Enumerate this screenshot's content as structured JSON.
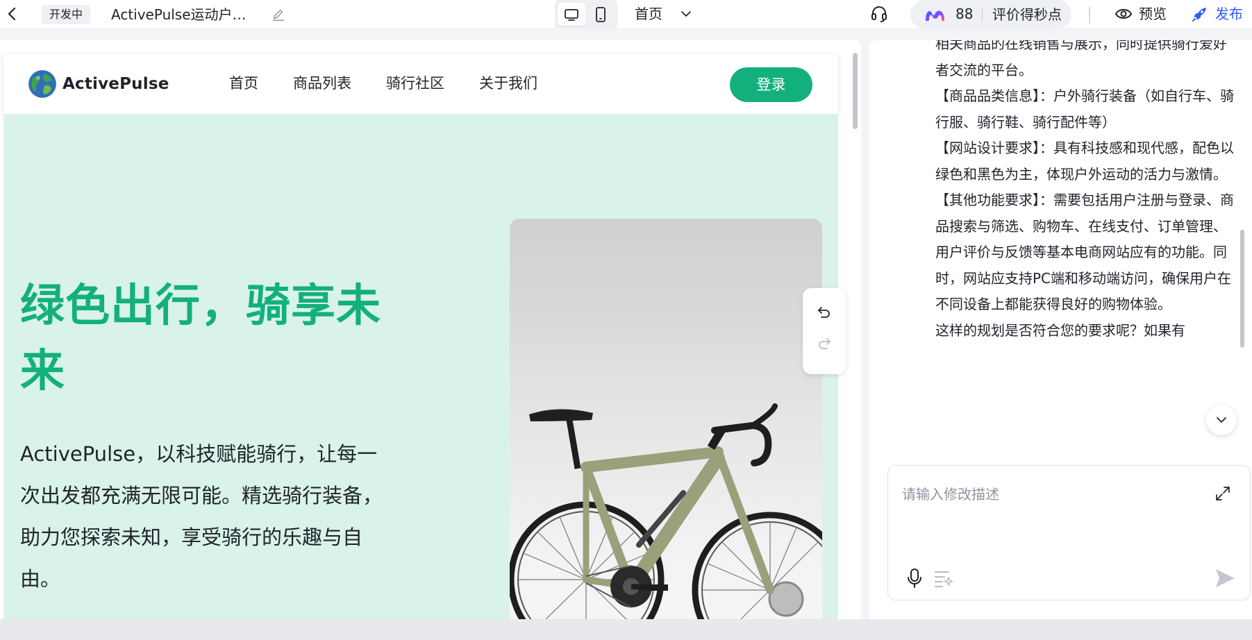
{
  "topbar": {
    "status_badge": "开发中",
    "project_title": "ActivePulse运动户…",
    "page_selector": "首页",
    "credits": "88",
    "rate_label": "评价得秒点",
    "preview_label": "预览",
    "publish_label": "发布",
    "accent_color": "#2b5cff"
  },
  "site": {
    "brand": "ActivePulse",
    "nav": [
      "首页",
      "商品列表",
      "骑行社区",
      "关于我们"
    ],
    "login": "登录",
    "hero_title": "绿色出行，骑享未来",
    "hero_desc": "ActivePulse，以科技赋能骑行，让每一次出发都充满无限可能。精选骑行装备，助力您探索未知，享受骑行的乐趣与自由。",
    "brand_color": "#13b07d",
    "hero_bg": "#d9f3e9"
  },
  "chat": {
    "paragraphs": [
      "相关商品的在线销售与展示，同时提供骑行爱好者交流的平台。",
      "【商品品类信息】：户外骑行装备（如自行车、骑行服、骑行鞋、骑行配件等）",
      "【网站设计要求】：具有科技感和现代感，配色以绿色和黑色为主，体现户外运动的活力与激情。",
      "【其他功能要求】：需要包括用户注册与登录、商品搜索与筛选、购物车、在线支付、订单管理、用户评价与反馈等基本电商网站应有的功能。同时，网站应支持PC端和移动端访问，确保用户在不同设备上都能获得良好的购物体验。",
      "这样的规划是否符合您的要求呢？如果有"
    ],
    "input_placeholder": "请输入修改描述"
  },
  "icons": [
    "back-arrow-icon",
    "edit-pencil-icon",
    "desktop-icon",
    "mobile-icon",
    "chevron-down-icon",
    "headset-icon",
    "brand-logo-icon",
    "eye-icon",
    "rocket-icon",
    "undo-icon",
    "redo-icon",
    "scroll-down-icon",
    "expand-icon",
    "microphone-icon",
    "prompt-list-icon",
    "send-icon"
  ]
}
